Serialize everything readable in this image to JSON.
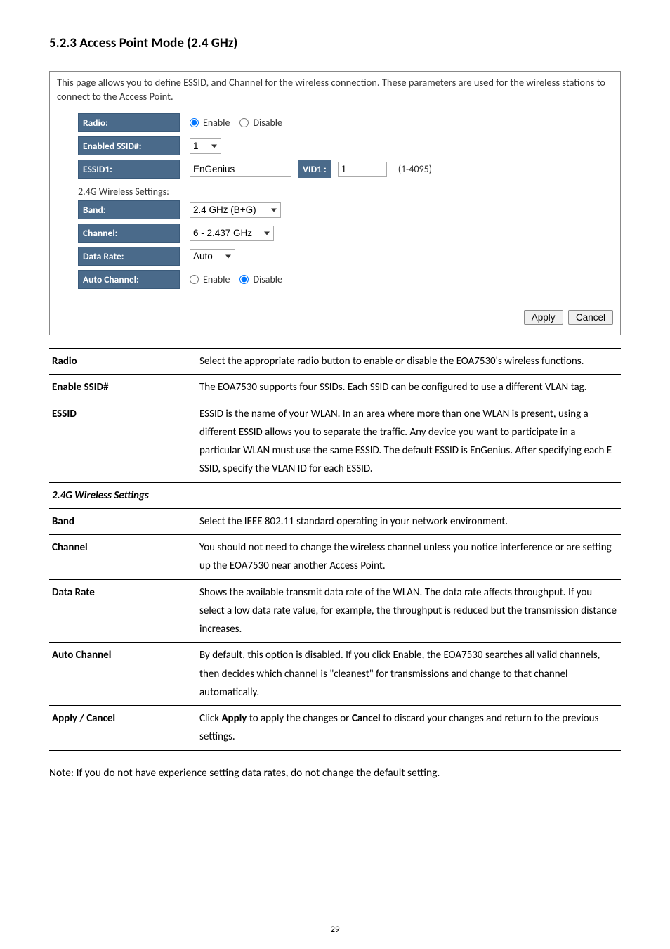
{
  "heading": "5.2.3 Access Point Mode (2.4 GHz)",
  "panel": {
    "intro": "This page allows you to define ESSID, and Channel for the wireless connection. These parameters are used for the wireless stations to connect to the Access Point.",
    "rows": {
      "radio_label": "Radio:",
      "radio_enable": "Enable",
      "radio_disable": "Disable",
      "enabled_ssid_label": "Enabled SSID#:",
      "enabled_ssid_value": "1",
      "essid1_label": "ESSID1:",
      "essid1_value": "EnGenius",
      "vid1_label": "VID1 :",
      "vid1_value": "1",
      "vid1_hint": "(1-4095)"
    },
    "sub_label": "2.4G Wireless Settings:",
    "sub": {
      "band_label": "Band:",
      "band_value": "2.4 GHz (B+G)",
      "channel_label": "Channel:",
      "channel_value": "6 - 2.437 GHz",
      "datarate_label": "Data Rate:",
      "datarate_value": "Auto",
      "autochan_label": "Auto Channel:",
      "ac_enable": "Enable",
      "ac_disable": "Disable"
    },
    "apply": "Apply",
    "cancel": "Cancel"
  },
  "defs": {
    "radio": {
      "term": "Radio",
      "desc": "Select the appropriate radio button to enable or disable the EOA7530's wireless functions."
    },
    "enable_ssid": {
      "term": "Enable SSID#",
      "desc": "The EOA7530 supports four SSIDs. Each SSID can be configured to use a different VLAN tag."
    },
    "essid": {
      "term": "ESSID",
      "desc": "ESSID is the name of your WLAN. In an area where more than one WLAN is present, using a different ESSID allows you to separate the traffic. Any device you want to participate in a particular WLAN must use the same ESSID. The default ESSID is EnGenius. After specifying each E SSID, specify the VLAN ID for each ESSID."
    },
    "subhead": {
      "term": "2.4G Wireless Settings"
    },
    "band": {
      "term": "Band",
      "desc": "Select the IEEE 802.11 standard operating in your network environment."
    },
    "channel": {
      "term": "Channel",
      "desc": "You should not need to change the wireless channel unless you notice interference or are setting up the EOA7530 near another Access Point."
    },
    "datarate": {
      "term": "Data Rate",
      "desc": "Shows the available transmit data rate of the WLAN. The data rate affects throughput. If you select a low data rate value, for example, the throughput is reduced but the transmission distance increases."
    },
    "autochan": {
      "term": "Auto Channel",
      "desc": "By default, this option is disabled. If you click Enable, the EOA7530 searches all valid channels, then decides which channel is \"cleanest\" for transmissions and change to that channel automatically."
    },
    "applycancel": {
      "term": "Apply / Cancel",
      "desc_pre": "Click ",
      "desc_b1": "Apply",
      "desc_mid": " to apply the changes or ",
      "desc_b2": "Cancel",
      "desc_post": " to discard your changes and return to the previous settings."
    }
  },
  "note": "Note: If you do not have experience setting data rates, do not change the default setting.",
  "page": "29"
}
